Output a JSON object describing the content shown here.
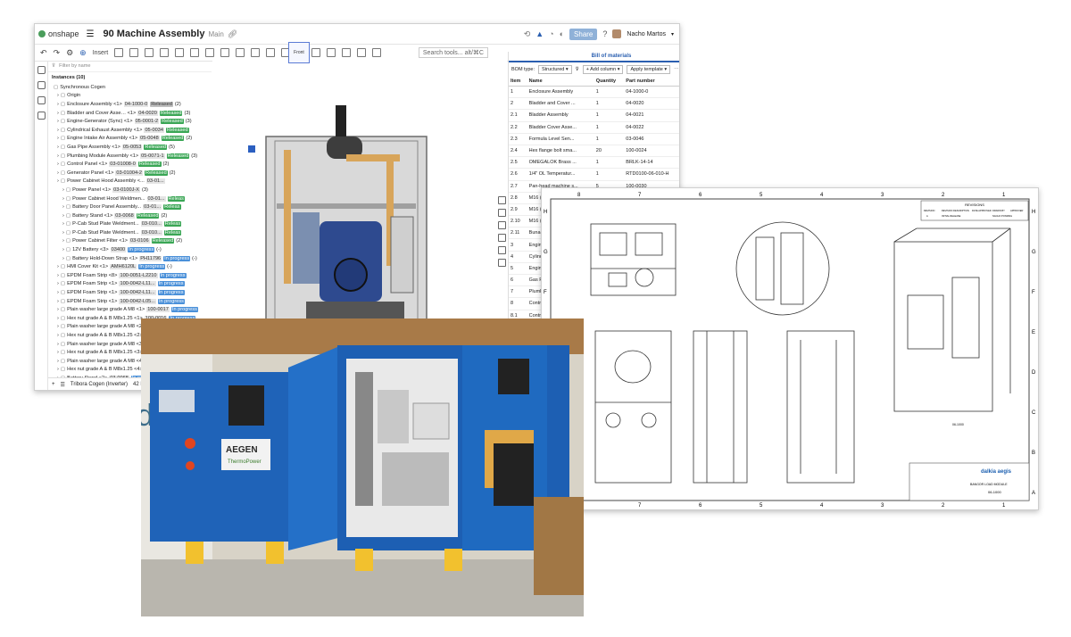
{
  "onshape": {
    "app_name": "onshape",
    "doc_title": "90 Machine Assembly",
    "branch": "Main",
    "share_label": "Share",
    "user": "Nacho Martos",
    "insert_label": "Insert",
    "search_placeholder": "Search tools...",
    "search_hint": "alt/⌘C",
    "tree_filter": "Filter by name",
    "instances_label": "Instances (10)",
    "tree_rows": [
      {
        "indent": 0,
        "name": "Synchronous Cogen",
        "pn": "",
        "badge": "",
        "badge_type": "",
        "count": ""
      },
      {
        "indent": 1,
        "name": "Origin",
        "pn": "",
        "badge": "",
        "badge_type": "",
        "count": ""
      },
      {
        "indent": 1,
        "name": "Enclosure Assembly <1>",
        "pn": "04-1000-0",
        "badge": "Released",
        "badge_type": "gray",
        "count": "(2)"
      },
      {
        "indent": 1,
        "name": "Bladder and Cover Asse… <1>",
        "pn": "04-0020",
        "badge": "Released",
        "badge_type": "rel",
        "count": "(3)"
      },
      {
        "indent": 1,
        "name": "Engine-Generator (Sync) <1>",
        "pn": "05-0001-2",
        "badge": "Released",
        "badge_type": "rel",
        "count": "(3)"
      },
      {
        "indent": 1,
        "name": "Cylindrical Exhaust Assembly <1>",
        "pn": "05-0034",
        "badge": "Released",
        "badge_type": "rel",
        "count": ""
      },
      {
        "indent": 1,
        "name": "Engine Intake Air Assembly <1>",
        "pn": "05-0048",
        "badge": "Released",
        "badge_type": "rel",
        "count": "(2)"
      },
      {
        "indent": 1,
        "name": "Gas Pipe Assembly <1>",
        "pn": "05-0053",
        "badge": "Released",
        "badge_type": "rel",
        "count": "(5)"
      },
      {
        "indent": 1,
        "name": "Plumbing Module Assembly <1>",
        "pn": "05-0071-1",
        "badge": "Released",
        "badge_type": "rel",
        "count": "(3)"
      },
      {
        "indent": 1,
        "name": "Control Panel <1>",
        "pn": "03-01008-0",
        "badge": "Released",
        "badge_type": "rel",
        "count": "(2)"
      },
      {
        "indent": 1,
        "name": "Generator Panel <1>",
        "pn": "03-01004-2",
        "badge": "Released",
        "badge_type": "rel",
        "count": "(2)"
      },
      {
        "indent": 1,
        "name": "Power Cabinet Hood Assembly <...",
        "pn": "03-01...",
        "badge": "",
        "badge_type": "",
        "count": ""
      },
      {
        "indent": 2,
        "name": "Power Panel <1>",
        "pn": "03-0100J-X",
        "badge": "",
        "badge_type": "",
        "count": "(3)"
      },
      {
        "indent": 2,
        "name": "Power Cabinet Hood Weldmen...",
        "pn": "03-01...",
        "badge": "Releas",
        "badge_type": "rel",
        "count": ""
      },
      {
        "indent": 2,
        "name": "Battery Door Panel Assembly...",
        "pn": "03-01...",
        "badge": "Releas",
        "badge_type": "rel",
        "count": ""
      },
      {
        "indent": 2,
        "name": "Battery Stand <1>",
        "pn": "03-0068",
        "badge": "Released",
        "badge_type": "rel",
        "count": "(2)"
      },
      {
        "indent": 2,
        "name": "P-Cab Stud Plate Weldment...",
        "pn": "03-010...",
        "badge": "Releas",
        "badge_type": "rel",
        "count": ""
      },
      {
        "indent": 2,
        "name": "P-Cab Stud Plate Weldment...",
        "pn": "03-010...",
        "badge": "Releas",
        "badge_type": "rel",
        "count": ""
      },
      {
        "indent": 2,
        "name": "Power Cabinet Filter <1>",
        "pn": "03-0106",
        "badge": "Released",
        "badge_type": "rel",
        "count": "(2)"
      },
      {
        "indent": 2,
        "name": "12V Battery <3>",
        "pn": "03400",
        "badge": "In progress",
        "badge_type": "inp",
        "count": "(-)"
      },
      {
        "indent": 2,
        "name": "Battery Hold-Down Strap <1>",
        "pn": "PH11796",
        "badge": "In progress",
        "badge_type": "inp",
        "count": "(-)"
      },
      {
        "indent": 1,
        "name": "HMI Cover Kit <1>",
        "pn": "AMH6120L",
        "badge": "In progress",
        "badge_type": "inp",
        "count": "(-)"
      },
      {
        "indent": 1,
        "name": "EPDM Foam Strip <8>",
        "pn": "100-0051-L2210",
        "badge": "In progress",
        "badge_type": "inp",
        "count": ""
      },
      {
        "indent": 1,
        "name": "EPDM Foam Strip <1>",
        "pn": "100-0042-L11...",
        "badge": "In progress",
        "badge_type": "inp",
        "count": ""
      },
      {
        "indent": 1,
        "name": "EPDM Foam Strip <1>",
        "pn": "100-0042-L11...",
        "badge": "In progress",
        "badge_type": "inp",
        "count": ""
      },
      {
        "indent": 1,
        "name": "EPDM Foam Strip <1>",
        "pn": "100-0042-L05...",
        "badge": "In progress",
        "badge_type": "inp",
        "count": ""
      },
      {
        "indent": 1,
        "name": "Plain washer large grade A M8 <1>",
        "pn": "100-0017",
        "badge": "In progress",
        "badge_type": "inp",
        "count": ""
      },
      {
        "indent": 1,
        "name": "Hex nut grade A & B M8x1.25 <1>",
        "pn": "100-0016",
        "badge": "In progress",
        "badge_type": "inp",
        "count": ""
      },
      {
        "indent": 1,
        "name": "Plain washer large grade A M8 <2>",
        "pn": "",
        "badge": "",
        "badge_type": "",
        "count": ""
      },
      {
        "indent": 1,
        "name": "Hex nut grade A & B M8x1.25 <2>",
        "pn": "100-0016",
        "badge": "In progress",
        "badge_type": "inp",
        "count": ""
      },
      {
        "indent": 1,
        "name": "Plain washer large grade A M8 <3>",
        "pn": "",
        "badge": "",
        "badge_type": "",
        "count": ""
      },
      {
        "indent": 1,
        "name": "Hex nut grade A & B M8x1.25 <3>",
        "pn": "",
        "badge": "",
        "badge_type": "",
        "count": ""
      },
      {
        "indent": 1,
        "name": "Plain washer large grade A M8 <4>",
        "pn": "",
        "badge": "",
        "badge_type": "",
        "count": ""
      },
      {
        "indent": 1,
        "name": "Hex nut grade A & B M8x1.25 <4>",
        "pn": "",
        "badge": "",
        "badge_type": "",
        "count": ""
      },
      {
        "indent": 1,
        "name": "Battery Stand <2>",
        "pn": "03-0068",
        "badge": "In progress",
        "badge_type": "inp",
        "count": ""
      }
    ],
    "bottom_tab": "Tribora Cogen (Inverter)",
    "bottom_tab2": "42 B...",
    "view_cube_label": "Front",
    "bom": {
      "title": "Bill of materials",
      "bom_type_label": "BOM type:",
      "bom_type_value": "Structured",
      "add_column": "Add column",
      "apply_template": "Apply template",
      "headers": [
        "Item",
        "Name",
        "Quantity",
        "Part number",
        "Revision"
      ],
      "rows": [
        [
          "1",
          "Enclosure Assembly",
          "1",
          "04-1000-0",
          "3"
        ],
        [
          "2",
          "Bladder and Cover ...",
          "1",
          "04-0020",
          "3"
        ],
        [
          "2.1",
          "Bladder Assembly",
          "1",
          "04-0021",
          "3"
        ],
        [
          "2.2",
          "Bladder Cover Asse...",
          "1",
          "04-0022",
          "3"
        ],
        [
          "2.3",
          "Formula Level Sen...",
          "1",
          "03-0046",
          "1"
        ],
        [
          "2.4",
          "Hex flange bolt sma...",
          "20",
          "100-0024",
          "-"
        ],
        [
          "2.5",
          "OMEGALOK Brass ...",
          "1",
          "BRLK-14-14",
          "-"
        ],
        [
          "2.6",
          "1/4\" OL Temperatur...",
          "1",
          "RTD0100-06-010-H",
          "-"
        ],
        [
          "2.7",
          "Pan-head machine s...",
          "5",
          "100-0030",
          "-"
        ],
        [
          "2.8",
          "M16 (m) Plug",
          "1",
          "",
          ""
        ],
        [
          "2.9",
          "M16 (m) x 3/8\" JIC L...",
          "",
          "",
          ""
        ],
        [
          "2.10",
          "M16 (m) x 1/2\" JIC L...",
          "",
          "",
          ""
        ],
        [
          "2.11",
          "Buna-N Foam Strip",
          "",
          "",
          ""
        ],
        [
          "3",
          "Engine-Generator (...",
          "",
          "",
          ""
        ],
        [
          "4",
          "Cylindrical Exhaust...",
          "",
          "",
          ""
        ],
        [
          "5",
          "Engine Intake Air A...",
          "",
          "",
          ""
        ],
        [
          "6",
          "Gas Pipe Assembly",
          "",
          "",
          ""
        ],
        [
          "7",
          "Plumbing Module A...",
          "",
          "",
          ""
        ],
        [
          "8",
          "Control Panel",
          "",
          "",
          ""
        ],
        [
          "8.1",
          "Control Panel Enclo...",
          "",
          "",
          ""
        ],
        [
          "8.1.1",
          "Enclosure Subpanel",
          "",
          "",
          ""
        ]
      ]
    }
  },
  "drawing": {
    "col_numbers": [
      "8",
      "7",
      "6",
      "5",
      "4",
      "3",
      "2",
      "1"
    ],
    "row_letters": [
      "H",
      "G",
      "F",
      "E",
      "D",
      "C",
      "B",
      "A"
    ],
    "revisions_title": "REVISIONS",
    "revisions_headers": [
      "REVISION",
      "REVISION DESCRIPTION",
      "DATE APPROVED",
      "DRAWN BY",
      "APPROVER"
    ],
    "revisions_row": [
      "A",
      "INITIAL RELEASE",
      "",
      "NACHO PONDING",
      ""
    ],
    "company": "dalkia aegis",
    "title": "BANGOR LOAD MODULE",
    "number": "06-1000",
    "view_label": "06-1000"
  },
  "photo": {
    "brand": "AEGEN",
    "brand_sub": "ThermoPower",
    "wall_text": "dee"
  }
}
